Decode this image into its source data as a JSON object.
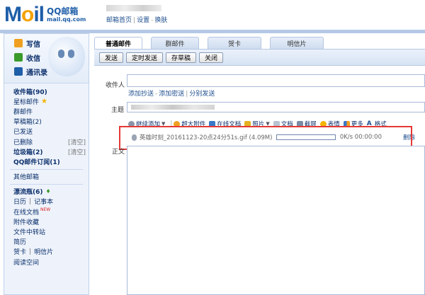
{
  "header": {
    "logo_big": [
      "M",
      "o",
      "il"
    ],
    "logo_cn": "QQ邮箱",
    "logo_url": "mail.qq.com",
    "links": [
      "邮箱首页",
      "设置",
      "换肤"
    ]
  },
  "quick": [
    {
      "label": "写信",
      "icon": "pencil-icon",
      "color": "#f0a020"
    },
    {
      "label": "收信",
      "icon": "inbox-icon",
      "color": "#3a9a2a"
    },
    {
      "label": "通讯录",
      "icon": "contacts-icon",
      "color": "#1f5ea8"
    }
  ],
  "folders": {
    "inbox": "收件箱(90)",
    "starred": "星标邮件",
    "group": "群邮件",
    "drafts": "草稿箱(2)",
    "sent": "已发送",
    "deleted": "已删除",
    "deleted_clear": "[清空]",
    "spam": "垃圾箱(2)",
    "spam_clear": "[清空]",
    "subscribe": "QQ邮件订阅(1)",
    "other": "其他邮箱",
    "bottle": "漂流瓶(6)",
    "calendar": "日历",
    "notes": "记事本",
    "docs": "在线文档",
    "docs_new": "NEW",
    "attach_fav": "附件收藏",
    "transfer": "文件中转站",
    "resume": "简历",
    "cards": "贺卡",
    "postcards": "明信片",
    "reading": "阅读空间"
  },
  "tabs": [
    "普通邮件",
    "群邮件",
    "贺卡",
    "明信片"
  ],
  "toolbar": {
    "send": "发送",
    "scheduled": "定时发送",
    "save_draft": "存草稿",
    "close": "关闭"
  },
  "compose": {
    "to_label": "收件人",
    "cc": "添加抄送",
    "bcc": "添加密送",
    "separate": "分别发送",
    "subject_label": "主题",
    "body_label": "正文"
  },
  "attach_bar": {
    "add": "继续添加",
    "super": "超大附件",
    "online_doc": "在线文档",
    "photo": "照片",
    "doc": "文档",
    "screenshot": "截屏",
    "emoji": "表情",
    "more": "更多",
    "format": "格式"
  },
  "attachment": {
    "name": "英雄时刻_20161123-20点24分51s.gif (4.09M)",
    "progress": 0,
    "speed": "0K/s 00:00:00",
    "delete": "删除"
  },
  "colors": {
    "frame": "#b5c9e6",
    "link": "#1f4f8f",
    "highlight": "#e53935",
    "progress": "#5b8ed6"
  }
}
